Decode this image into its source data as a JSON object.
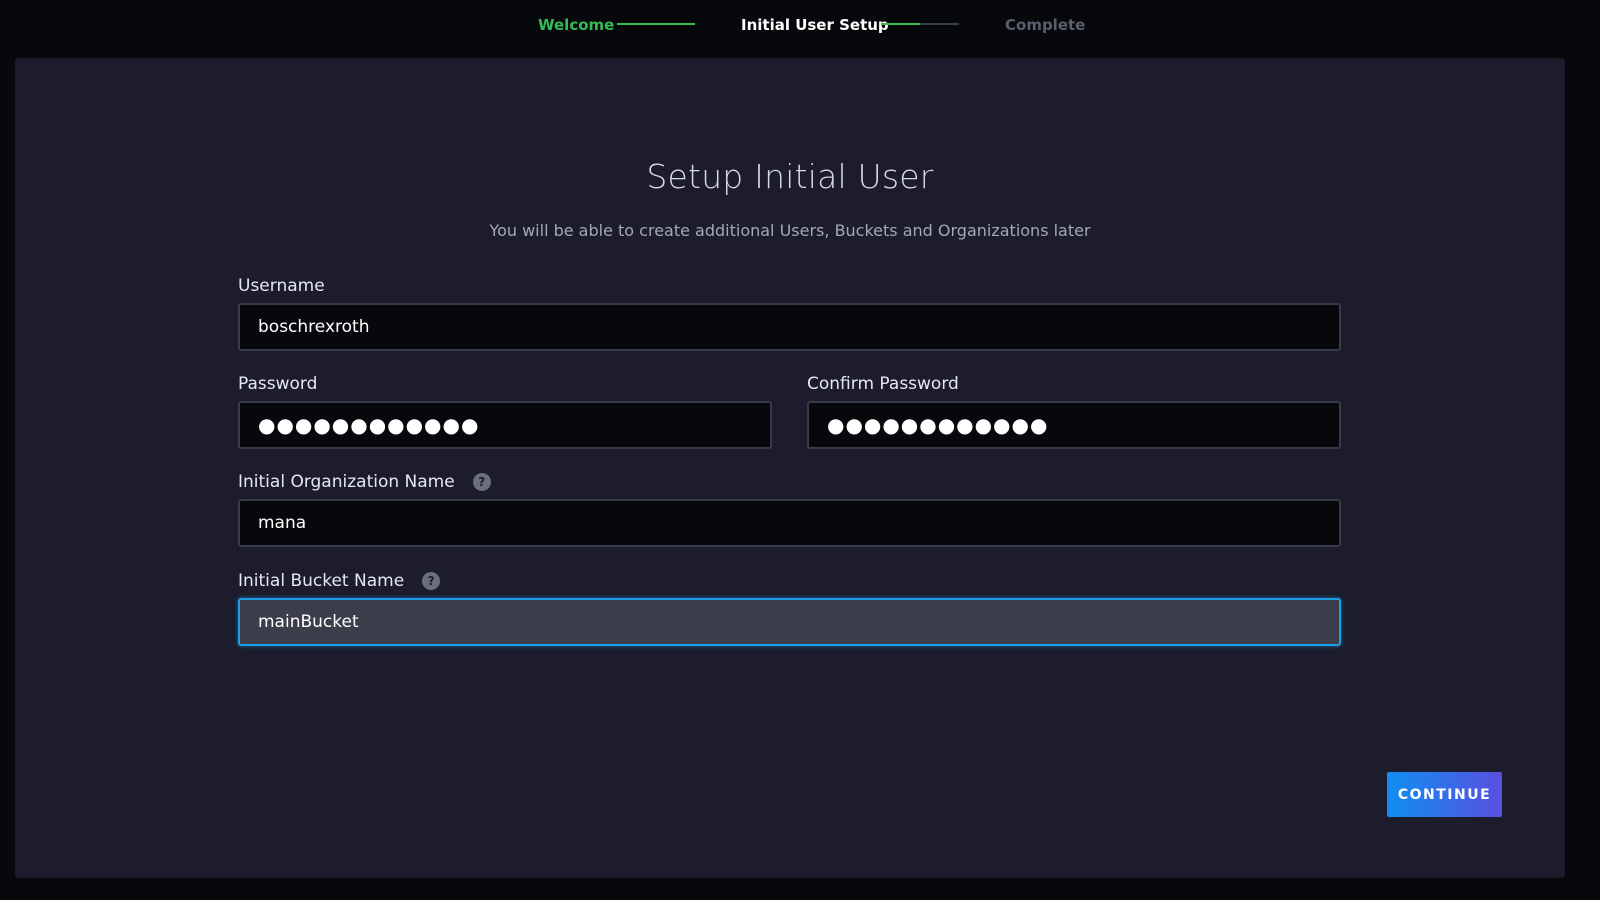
{
  "stepper": {
    "steps": [
      {
        "label": "Welcome",
        "state": "done"
      },
      {
        "label": "Initial User Setup",
        "state": "active"
      },
      {
        "label": "Complete",
        "state": "pending"
      }
    ],
    "active_connector_progress": 0.5,
    "colors": {
      "done": "#34bb55",
      "active": "#ffffff",
      "pending": "#5b5e6b"
    }
  },
  "form": {
    "title": "Setup Initial User",
    "subtitle": "You will be able to create additional Users, Buckets and Organizations later",
    "username": {
      "label": "Username",
      "value": "boschrexroth"
    },
    "password": {
      "label": "Password",
      "value": "●●●●●●●●●●●●"
    },
    "confirm_password": {
      "label": "Confirm Password",
      "value": "●●●●●●●●●●●●"
    },
    "org_name": {
      "label": "Initial Organization Name",
      "value": "mana",
      "help_icon": "question-circle-icon"
    },
    "bucket_name": {
      "label": "Initial Bucket Name",
      "value": "mainBucket",
      "help_icon": "question-circle-icon",
      "focused": true
    }
  },
  "actions": {
    "continue_label": "CONTINUE"
  },
  "colors": {
    "accent_green": "#34bb55",
    "focus_blue": "#1d9fe8",
    "panel_bg": "#1c1c2c",
    "page_bg": "#07080c",
    "button_gradient_start": "#0f8ff2",
    "button_gradient_end": "#5a4fe0"
  }
}
